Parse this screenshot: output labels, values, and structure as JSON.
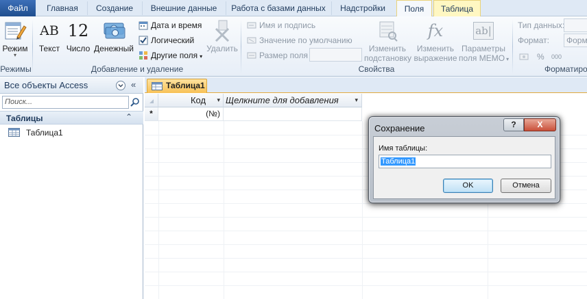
{
  "tabs": {
    "file": "Файл",
    "home": "Главная",
    "create": "Создание",
    "external": "Внешние данные",
    "dbtools": "Работа с базами данных",
    "addins": "Надстройки",
    "fields": "Поля",
    "table": "Таблица"
  },
  "ribbon": {
    "views": {
      "mode_label": "Режим",
      "group_label": "Режимы"
    },
    "add_delete": {
      "text_label": "Текст",
      "text_icon": "AB",
      "number_label": "Число",
      "number_icon": "12",
      "currency_label": "Денежный",
      "datetime_label": "Дата и время",
      "logical_label": "Логический",
      "more_fields_label": "Другие поля",
      "delete_label": "Удалить",
      "group_label": "Добавление и удаление"
    },
    "properties": {
      "name_caption_label": "Имя и подпись",
      "default_value_label": "Значение по умолчанию",
      "field_size_label": "Размер поля",
      "modify_lookups_label_1": "Изменить",
      "modify_lookups_label_2": "подстановку",
      "modify_expression_label_1": "Изменить",
      "modify_expression_label_2": "выражение",
      "memo_settings_label_1": "Параметры",
      "memo_settings_label_2": "поля MEMO",
      "memo_icon_text": "ab|",
      "fx_icon_text": "fx",
      "group_label": "Свойства"
    },
    "formatting": {
      "data_type_label": "Тип данных:",
      "format_label": "Формат:",
      "format_truncated": "Форм",
      "percent_symbol": "%",
      "thousands_symbol": "000",
      "group_label": "Форматиро"
    }
  },
  "nav_pane": {
    "title": "Все объекты Access",
    "search_placeholder": "Поиск...",
    "group_title": "Таблицы",
    "items": [
      {
        "label": "Таблица1"
      }
    ]
  },
  "document": {
    "tab_label": "Таблица1",
    "columns": [
      {
        "header": "Код"
      },
      {
        "header": "Щелкните для добавления"
      }
    ],
    "new_row_marker": "*",
    "new_row_value": "(№)"
  },
  "dialog": {
    "title": "Сохранение",
    "help_glyph": "?",
    "close_glyph": "X",
    "field_label": "Имя таблицы:",
    "field_value": "Таблица1",
    "ok_label": "OK",
    "cancel_label": "Отмена"
  },
  "colors": {
    "file_tab": "#2b579a",
    "ribbon_bg": "#e7eef7",
    "doc_tab": "#f7c157",
    "context_tab": "#fff7c2",
    "selection": "#3399ff"
  }
}
